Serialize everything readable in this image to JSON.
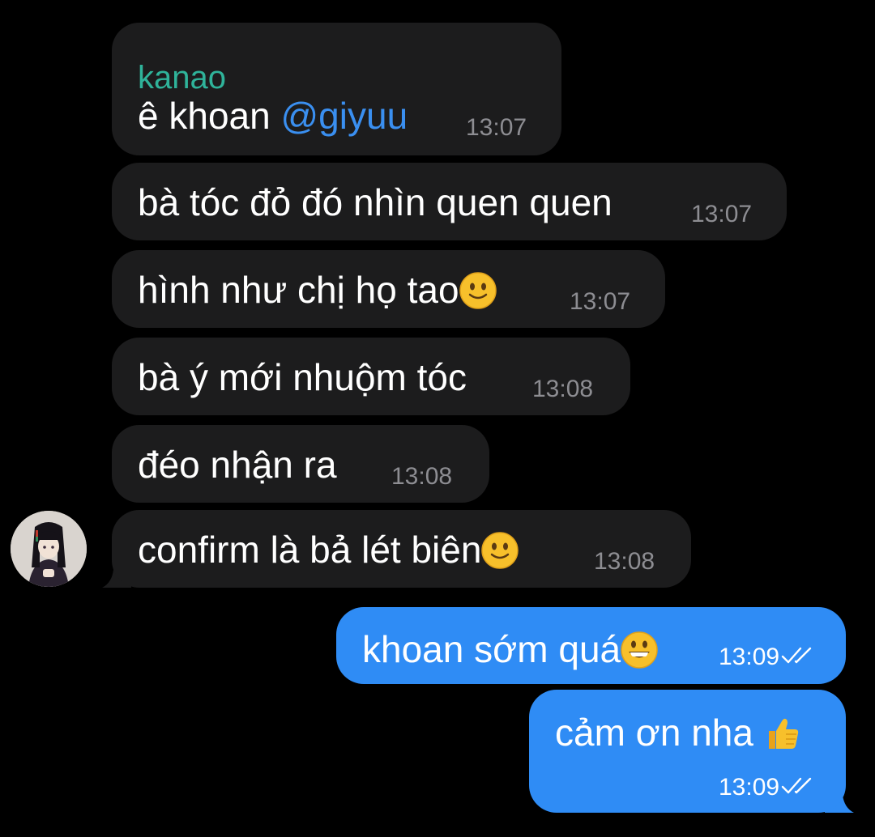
{
  "chat": {
    "messages": [
      {
        "sender": "kanao",
        "text": "ê khoan ",
        "mention": "@giyuu",
        "time": "13:07"
      },
      {
        "text": "bà tóc đỏ đó nhìn quen quen",
        "time": "13:07"
      },
      {
        "text": "hình như chị họ tao",
        "emoji": "slightly-smiling-face-icon",
        "time": "13:07"
      },
      {
        "text": "bà ý mới nhuộm tóc",
        "time": "13:08"
      },
      {
        "text": "đéo nhận ra",
        "time": "13:08"
      },
      {
        "text": "confirm là bả lét biên",
        "emoji": "slightly-smiling-face-icon",
        "time": "13:08"
      },
      {
        "text": "khoan sớm quá",
        "emoji": "grinning-face-icon",
        "time": "13:09",
        "read": true
      },
      {
        "text": "cảm ơn nha ",
        "emoji": "thumbs-up-icon",
        "time": "13:09",
        "read": true
      }
    ]
  },
  "colors": {
    "background": "#000000",
    "incoming_bubble": "#1c1c1d",
    "outgoing_bubble": "#2f8cf5",
    "sender_name": "#2fb39a",
    "mention": "#3a8ff0",
    "incoming_time": "#8d8d92"
  }
}
